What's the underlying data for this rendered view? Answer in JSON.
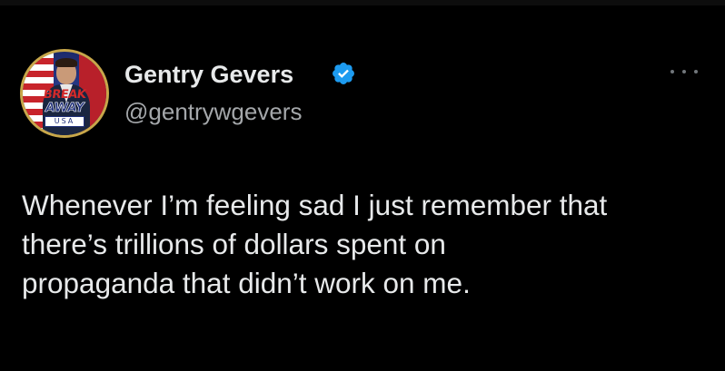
{
  "author": {
    "display_name": "Gentry Gevers",
    "handle": "@gentrywgevers",
    "verified": true,
    "verified_color": "#1d9bf0",
    "avatar": {
      "logo_top": "BREAK",
      "logo_mid": "AWAY",
      "logo_bottom": "USA"
    }
  },
  "tweet": {
    "lines": [
      "Whenever I’m feeling sad I just remember that",
      "there’s trillions of dollars spent on",
      "propaganda that didn’t work on me."
    ]
  },
  "menu": {
    "icon": "more-horizontal-icon"
  },
  "colors": {
    "background": "#000000",
    "text_primary": "#e7e9ea",
    "text_secondary": "#a4a7aa",
    "accent": "#1d9bf0"
  }
}
